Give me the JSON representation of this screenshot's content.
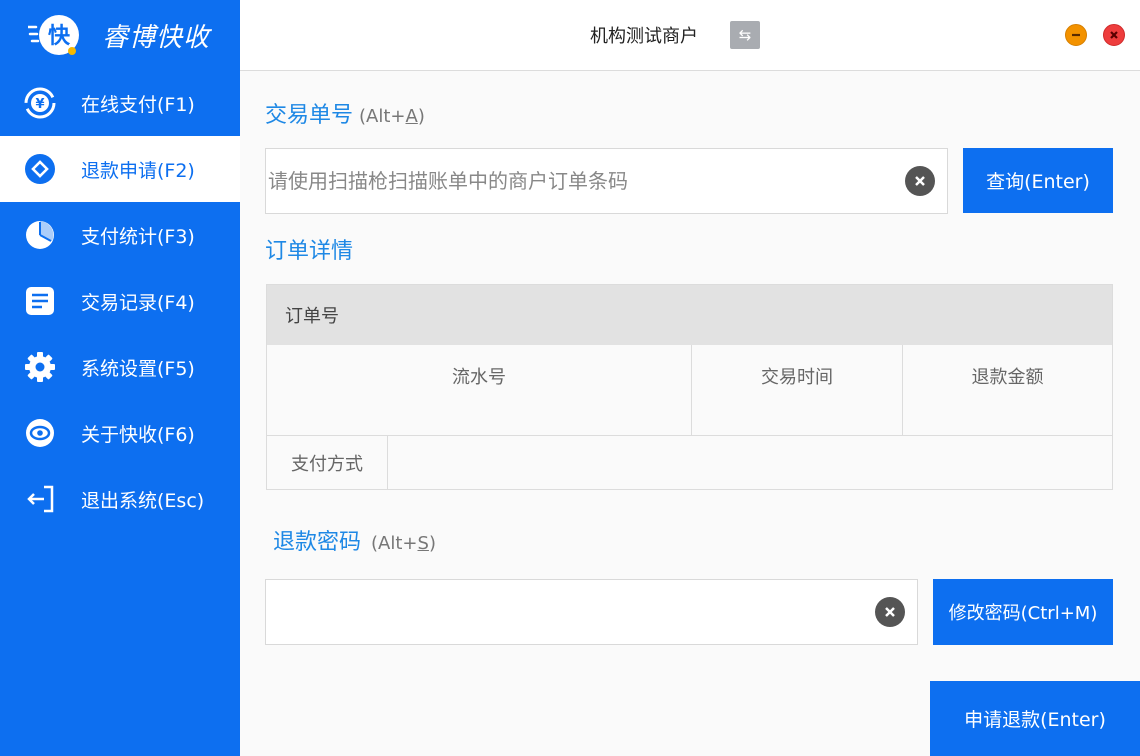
{
  "app": {
    "brand_name": "睿博快收",
    "logo_char": "快"
  },
  "sidebar": {
    "items": [
      {
        "label": "在线支付(F1)",
        "icon": "yuan-refresh-icon",
        "active": false
      },
      {
        "label": "退款申请(F2)",
        "icon": "diamond-circle-icon",
        "active": true
      },
      {
        "label": "支付统计(F3)",
        "icon": "pie-chart-icon",
        "active": false
      },
      {
        "label": "交易记录(F4)",
        "icon": "document-list-icon",
        "active": false
      },
      {
        "label": "系统设置(F5)",
        "icon": "gear-icon",
        "active": false
      },
      {
        "label": "关于快收(F6)",
        "icon": "eye-icon",
        "active": false
      },
      {
        "label": "退出系统(Esc)",
        "icon": "logout-icon",
        "active": false
      }
    ]
  },
  "header": {
    "title": "机构测试商户",
    "switch_glyph": "⇆"
  },
  "transaction": {
    "title": "交易单号",
    "hint_prefix": "(Alt+",
    "hint_key": "A",
    "hint_suffix": ")",
    "placeholder": "请使用扫描枪扫描账单中的商户订单条码",
    "value": "",
    "query_button": "查询(Enter)"
  },
  "order": {
    "title": "订单详情",
    "header_label": "订单号",
    "columns": [
      "流水号",
      "交易时间",
      "退款金额"
    ],
    "pay_method_label": "支付方式",
    "pay_method_value": ""
  },
  "refund_password": {
    "title": "退款密码",
    "hint_prefix": "(Alt+",
    "hint_key": "S",
    "hint_suffix": ")",
    "value": "",
    "change_button": "修改密码(Ctrl+M)"
  },
  "submit_button": "申请退款(Enter)",
  "colors": {
    "primary": "#0d6ff0",
    "section_title": "#1e88e5",
    "minimize": "#f39200",
    "close": "#ee3d3d"
  }
}
